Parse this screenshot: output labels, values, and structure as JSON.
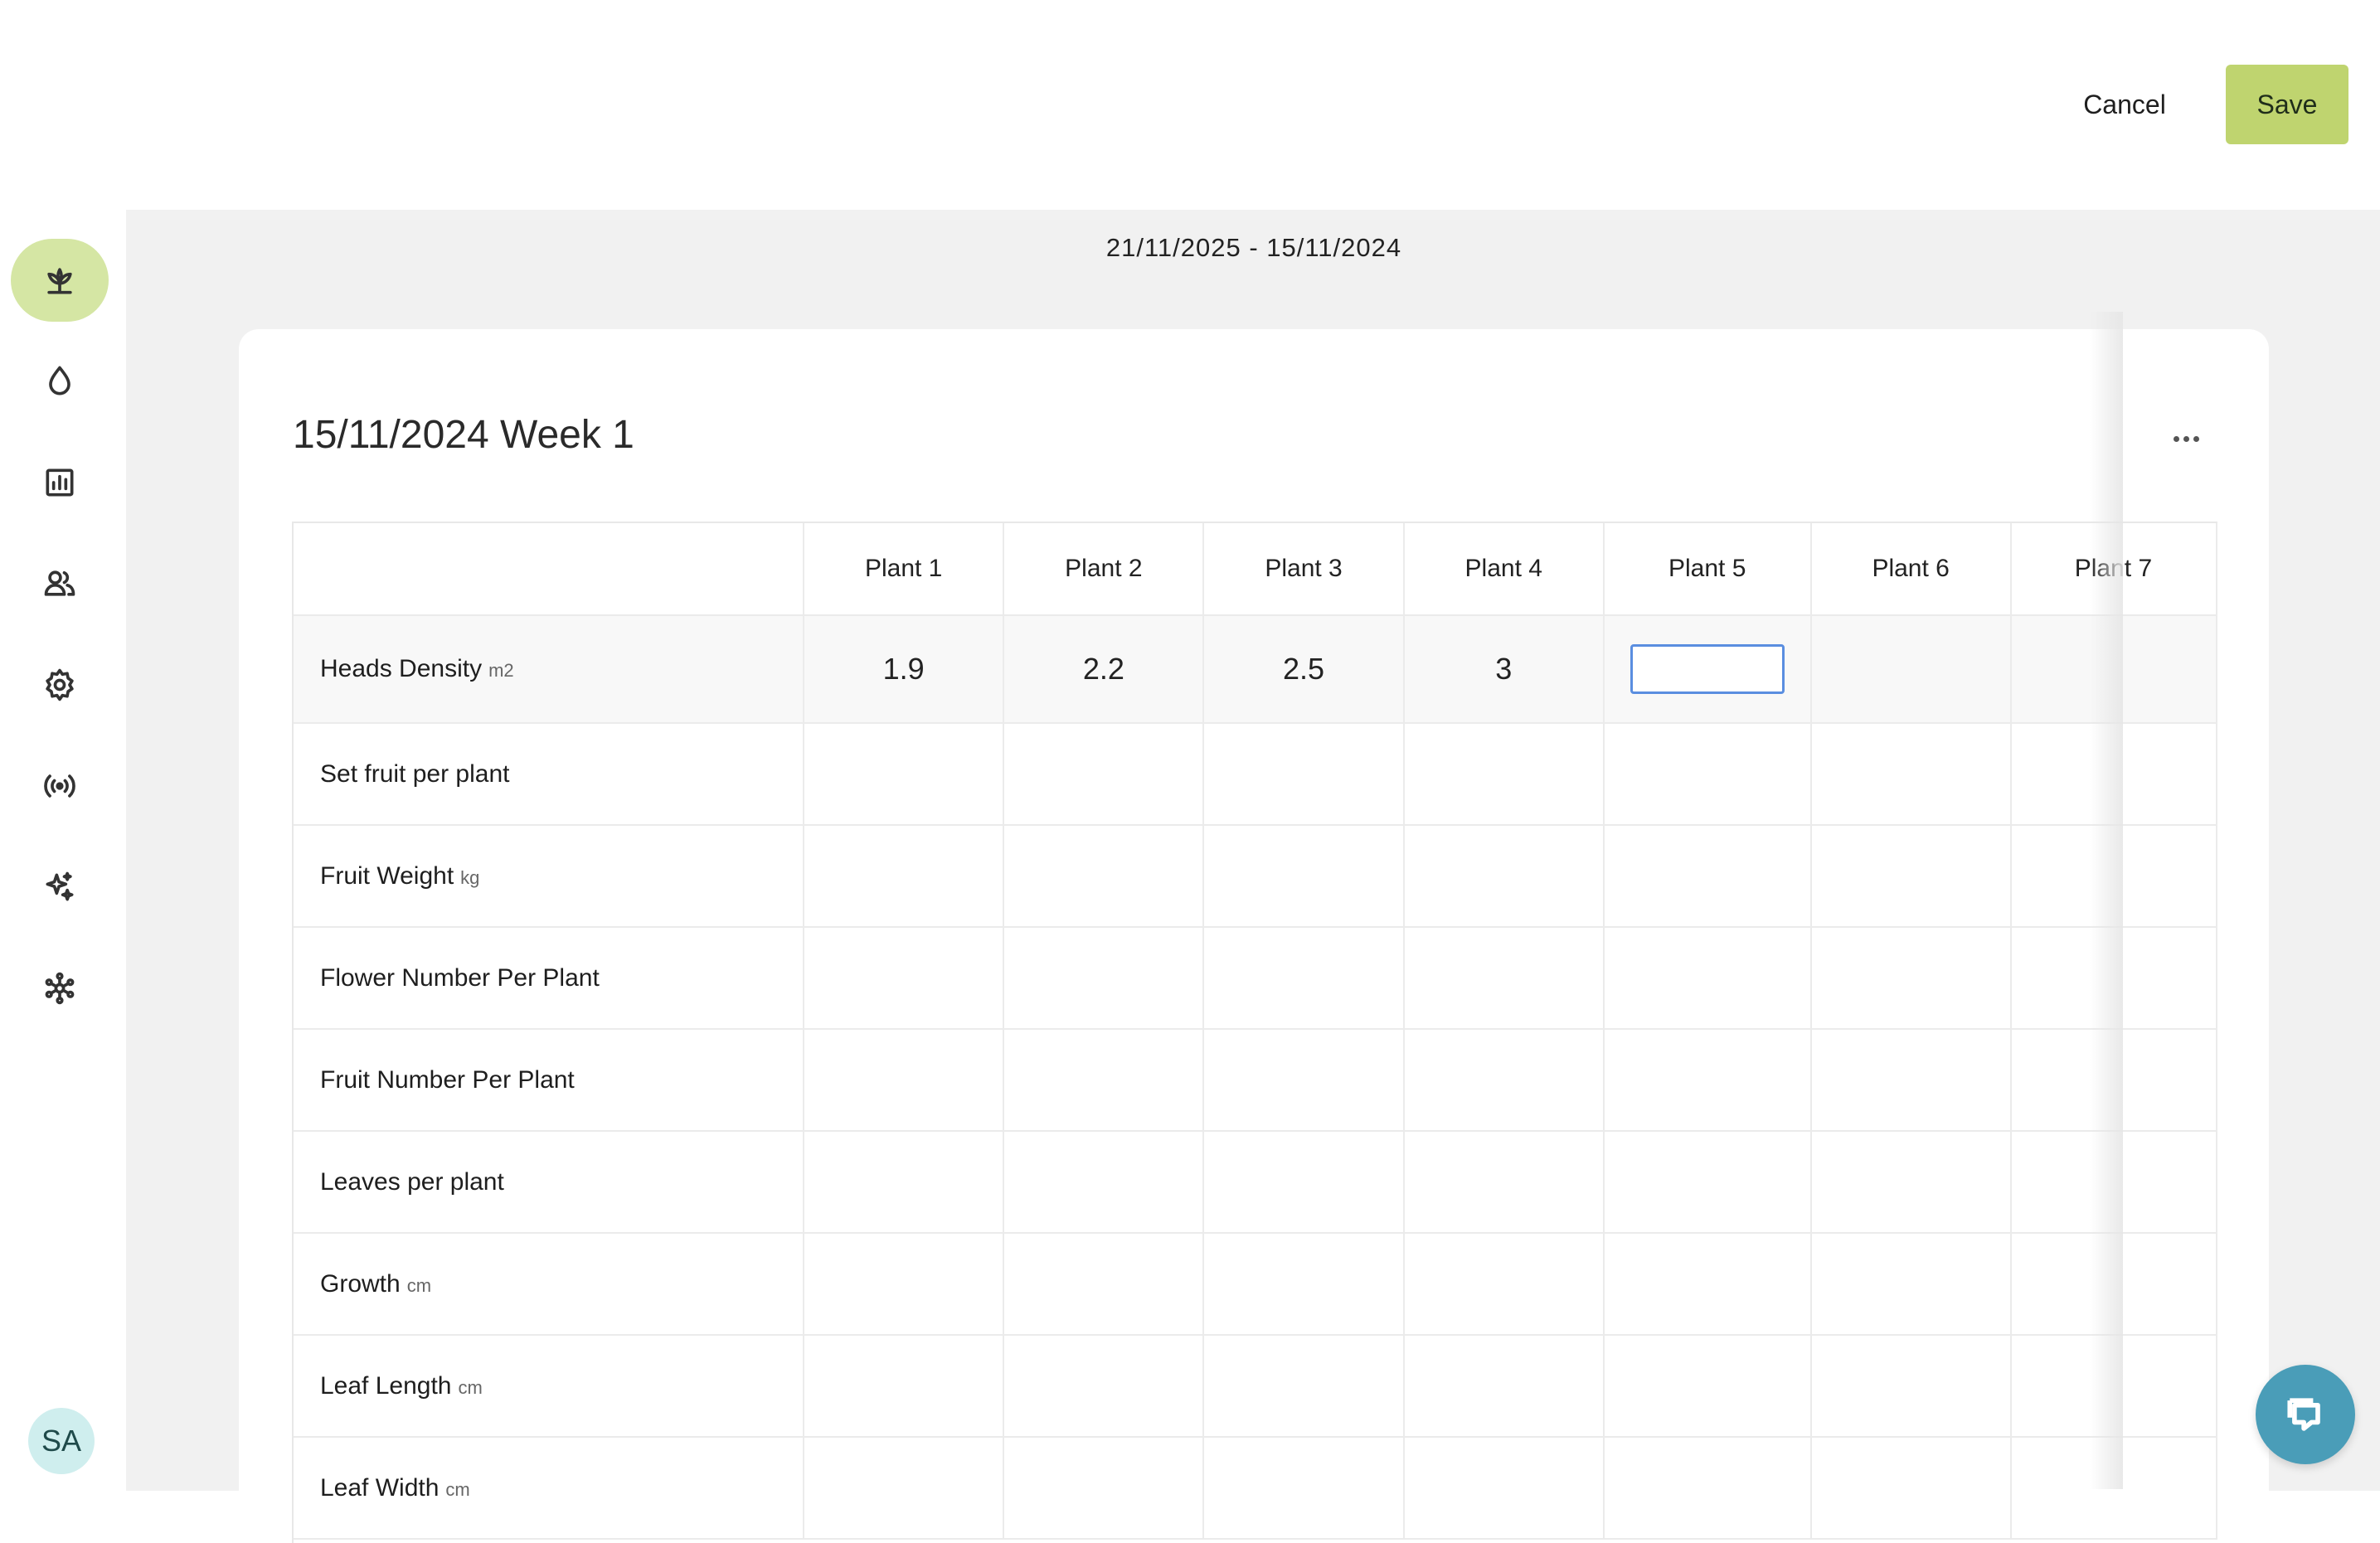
{
  "header": {
    "cancel_label": "Cancel",
    "save_label": "Save"
  },
  "sidebar": {
    "items": [
      {
        "icon": "plant-icon",
        "active": true
      },
      {
        "icon": "water-drop-icon"
      },
      {
        "icon": "chart-icon"
      },
      {
        "icon": "users-icon"
      },
      {
        "icon": "gear-icon"
      },
      {
        "icon": "signal-icon"
      },
      {
        "icon": "sparkle-icon"
      },
      {
        "icon": "network-icon"
      }
    ],
    "avatar_initials": "SA"
  },
  "main": {
    "date_range": "21/11/2025 - 15/11/2024",
    "card": {
      "title": "15/11/2024 Week 1",
      "columns": [
        "Plant 1",
        "Plant 2",
        "Plant 3",
        "Plant 4",
        "Plant 5",
        "Plant 6",
        "Plant 7"
      ],
      "rows": [
        {
          "label": "Heads Density",
          "unit": "m2",
          "values": [
            "1.9",
            "2.2",
            "2.5",
            "3",
            "",
            "",
            ""
          ]
        },
        {
          "label": "Set fruit per plant",
          "unit": "",
          "values": [
            "",
            "",
            "",
            "",
            "",
            "",
            ""
          ]
        },
        {
          "label": "Fruit Weight",
          "unit": "kg",
          "values": [
            "",
            "",
            "",
            "",
            "",
            "",
            ""
          ]
        },
        {
          "label": "Flower Number Per Plant",
          "unit": "",
          "values": [
            "",
            "",
            "",
            "",
            "",
            "",
            ""
          ]
        },
        {
          "label": "Fruit Number Per Plant",
          "unit": "",
          "values": [
            "",
            "",
            "",
            "",
            "",
            "",
            ""
          ]
        },
        {
          "label": "Leaves per plant",
          "unit": "",
          "values": [
            "",
            "",
            "",
            "",
            "",
            "",
            ""
          ]
        },
        {
          "label": "Growth",
          "unit": "cm",
          "values": [
            "",
            "",
            "",
            "",
            "",
            "",
            ""
          ]
        },
        {
          "label": "Leaf Length",
          "unit": "cm",
          "values": [
            "",
            "",
            "",
            "",
            "",
            "",
            ""
          ]
        },
        {
          "label": "Leaf Width",
          "unit": "cm",
          "values": [
            "",
            "",
            "",
            "",
            "",
            "",
            ""
          ]
        }
      ],
      "active_cell": {
        "row": 0,
        "column": 4,
        "value": ""
      }
    }
  },
  "colors": {
    "accent": "#bfd46f",
    "active_nav": "#d5e6a4",
    "fab": "#4a9db8",
    "focus": "#5a8ee0"
  }
}
